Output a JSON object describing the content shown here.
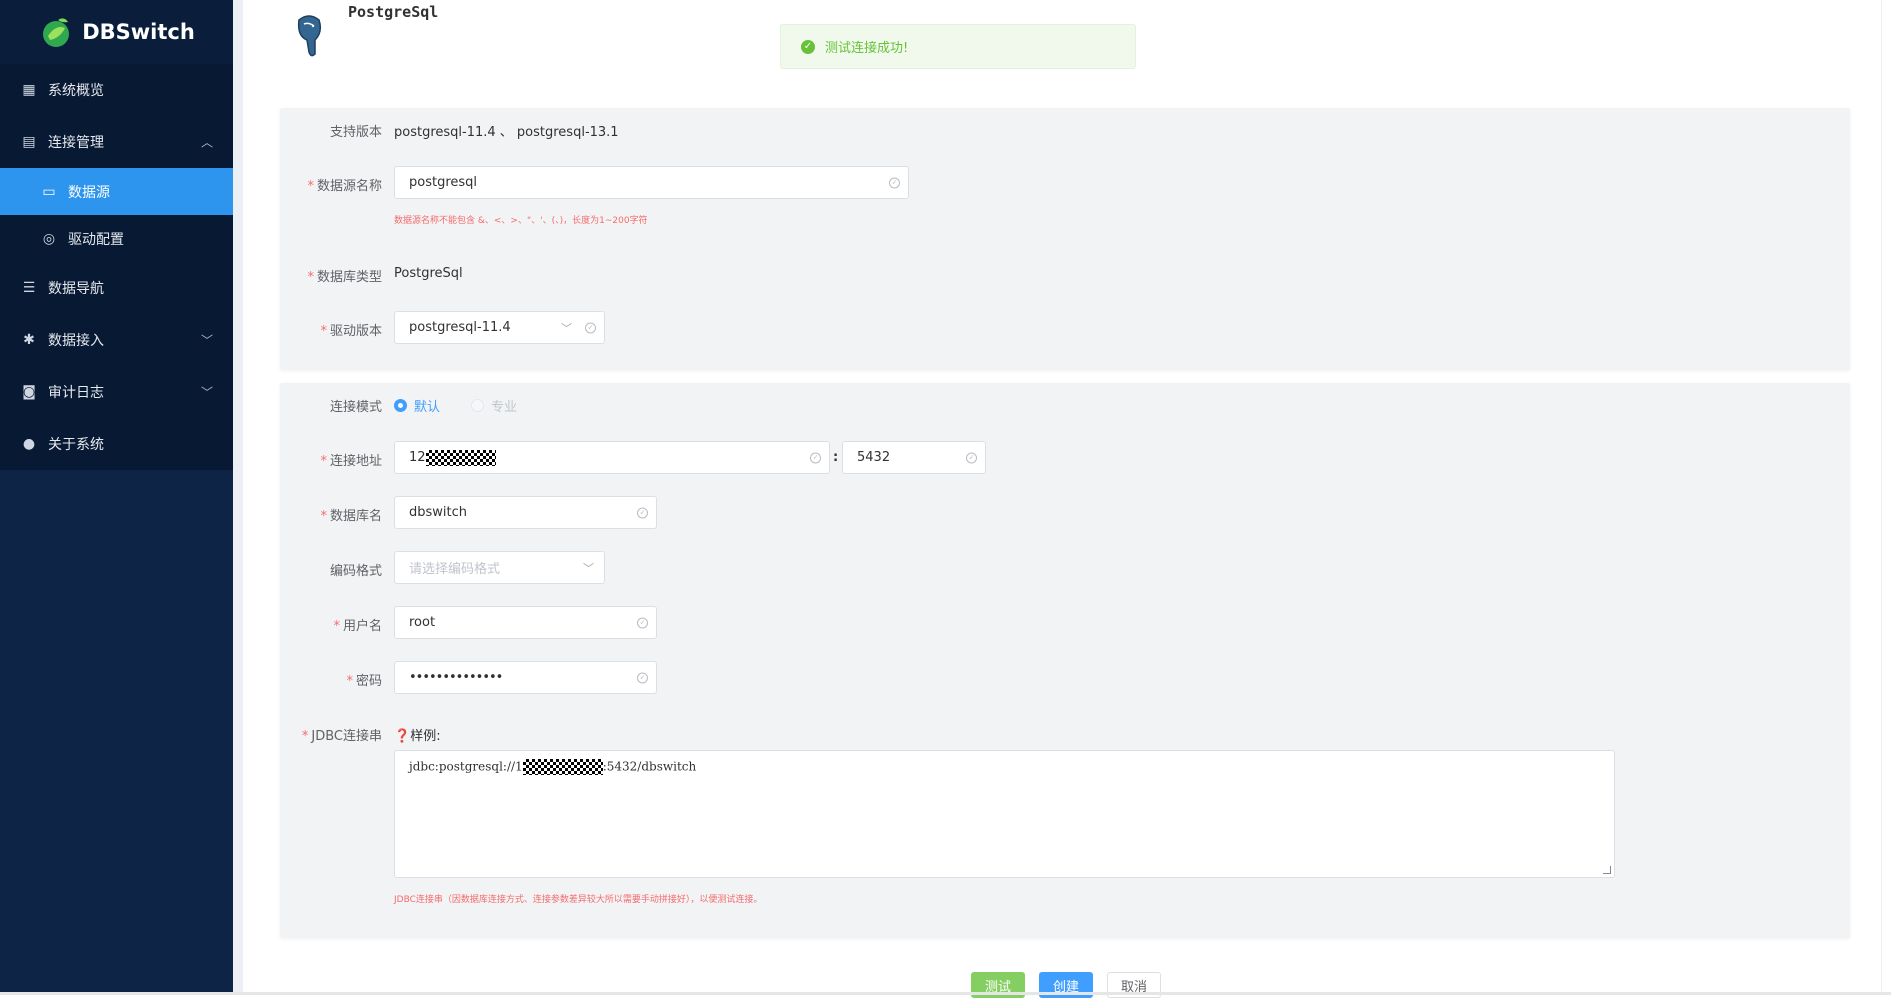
{
  "app": {
    "name": "DBSwitch"
  },
  "sidebar": {
    "items": [
      {
        "label": "系统概览",
        "icon": "grid-icon"
      },
      {
        "label": "连接管理",
        "icon": "clipboard-icon",
        "expanded": true,
        "children": [
          {
            "label": "数据源",
            "icon": "card-icon",
            "active": true
          },
          {
            "label": "驱动配置",
            "icon": "gear-outline-icon"
          }
        ]
      },
      {
        "label": "数据导航",
        "icon": "database-icon"
      },
      {
        "label": "数据接入",
        "icon": "gear-icon"
      },
      {
        "label": "审计日志",
        "icon": "log-icon"
      },
      {
        "label": "关于系统",
        "icon": "user-icon"
      }
    ]
  },
  "header": {
    "title": "PostgreSql"
  },
  "toast": {
    "message": "测试连接成功!",
    "type": "success"
  },
  "form": {
    "supported_label": "支持版本",
    "supported_value": "postgresql-11.4 、 postgresql-13.1",
    "name_label": "数据源名称",
    "name_value": "postgresql",
    "name_hint": "数据源名称不能包含 &、<、>、\"、'、(、)，长度为1~200字符",
    "type_label": "数据库类型",
    "type_value": "PostgreSql",
    "driver_label": "驱动版本",
    "driver_value": "postgresql-11.4",
    "mode_label": "连接模式",
    "mode_default": "默认",
    "mode_pro": "专业",
    "host_label": "连接地址",
    "host_prefix": "12",
    "port_sep": ":",
    "port_value": "5432",
    "db_label": "数据库名",
    "db_value": "dbswitch",
    "encoding_label": "编码格式",
    "encoding_placeholder": "请选择编码格式",
    "user_label": "用户名",
    "user_value": "root",
    "password_label": "密码",
    "password_value": "••••••••••••••",
    "jdbc_label": "JDBC连接串",
    "jdbc_example_label": "样例:",
    "jdbc_prefix": "jdbc:postgresql://1",
    "jdbc_suffix": ":5432/dbswitch",
    "jdbc_hint": "JDBC连接串（因数据库连接方式、连接参数差异较大所以需要手动拼接好），以便测试连接。"
  },
  "buttons": {
    "test": "测试",
    "create": "创建",
    "cancel": "取消"
  },
  "colors": {
    "sidebar_bg": "#0d2446",
    "active_item": "#2e95ee",
    "primary": "#409eff",
    "success": "#67c23a",
    "danger": "#f56c6c"
  }
}
